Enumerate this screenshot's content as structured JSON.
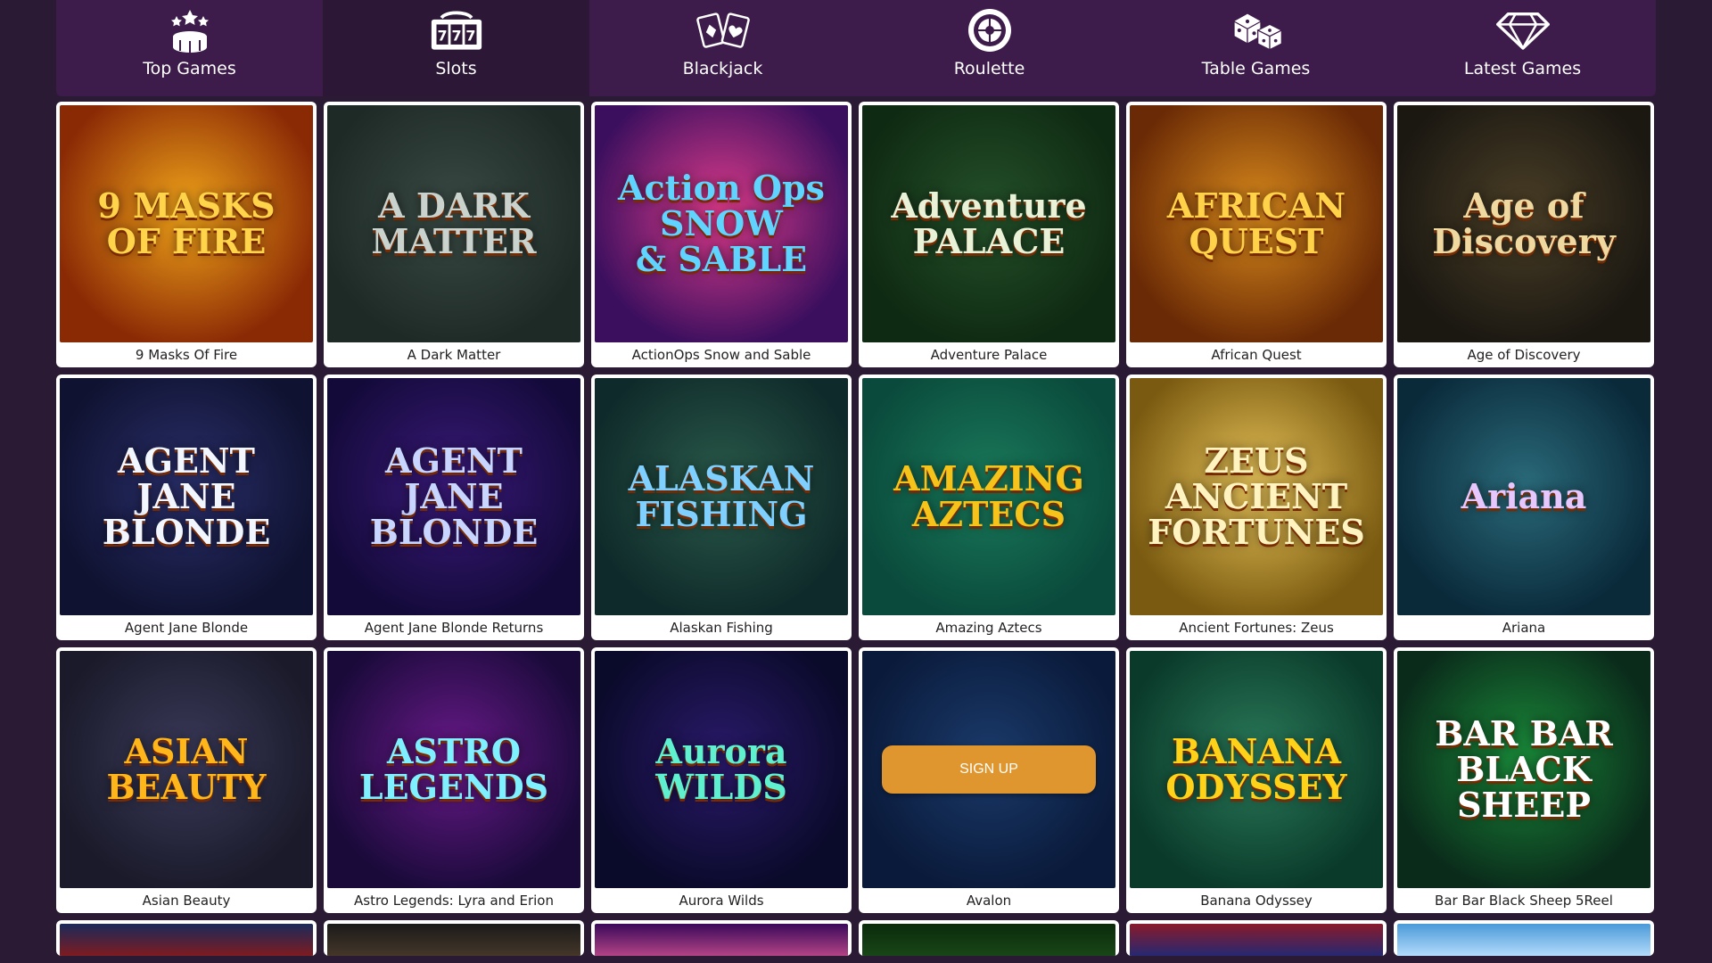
{
  "tabs": [
    {
      "label": "Top Games",
      "icon": "top-games-icon",
      "active": false
    },
    {
      "label": "Slots",
      "icon": "slot-machine-icon",
      "active": true
    },
    {
      "label": "Blackjack",
      "icon": "cards-icon",
      "active": false
    },
    {
      "label": "Roulette",
      "icon": "roulette-icon",
      "active": false
    },
    {
      "label": "Table Games",
      "icon": "dice-icon",
      "active": false
    },
    {
      "label": "Latest Games",
      "icon": "diamond-icon",
      "active": false
    }
  ],
  "games": [
    {
      "name": "9 Masks Of Fire",
      "art": "9 MASKS\nOF FIRE",
      "bg": "#8a2a05",
      "bg2": "#f2a51a",
      "ink": "#ffd34a"
    },
    {
      "name": "A Dark Matter",
      "art": "A DARK\nMATTER",
      "bg": "#1e2a26",
      "bg2": "#3a4a44",
      "ink": "#c9d2cc"
    },
    {
      "name": "ActionOps Snow and Sable",
      "art": "Action Ops\nSNOW\n& SABLE",
      "bg": "#3b0f5e",
      "bg2": "#e03c8c",
      "ink": "#5fd4ff"
    },
    {
      "name": "Adventure Palace",
      "art": "Adventure\nPALACE",
      "bg": "#0f2a12",
      "bg2": "#24502a",
      "ink": "#e9f1d6"
    },
    {
      "name": "African Quest",
      "art": "AFRICAN\nQUEST",
      "bg": "#6a2a05",
      "bg2": "#d98a1c",
      "ink": "#ffd24a"
    },
    {
      "name": "Age of Discovery",
      "art": "Age of\nDiscovery",
      "bg": "#1b1812",
      "bg2": "#4a3e26",
      "ink": "#f0d9a0"
    },
    {
      "name": "Agent Jane Blonde",
      "art": "AGENT JANE\nBLONDE",
      "bg": "#0f1230",
      "bg2": "#2a2f6a",
      "ink": "#f2f6ff"
    },
    {
      "name": "Agent Jane Blonde Returns",
      "art": "AGENT\nJANE\nBLONDE",
      "bg": "#140a3a",
      "bg2": "#3a1a7a",
      "ink": "#c8d6ff"
    },
    {
      "name": "Alaskan Fishing",
      "art": "ALASKAN\nFISHING",
      "bg": "#0f2a2a",
      "bg2": "#2a5a4a",
      "ink": "#7fd0ff"
    },
    {
      "name": "Amazing Aztecs",
      "art": "AMAZING\nAZTECS",
      "bg": "#0a4a3c",
      "bg2": "#1a7a5a",
      "ink": "#f5c31a"
    },
    {
      "name": "Ancient Fortunes: Zeus",
      "art": "ZEUS\nANCIENT FORTUNES",
      "bg": "#7a5a10",
      "bg2": "#e8c45a",
      "ink": "#fff3c0"
    },
    {
      "name": "Ariana",
      "art": "Ariana",
      "bg": "#0a2a3a",
      "bg2": "#2a6a7a",
      "ink": "#e6c8ff"
    },
    {
      "name": "Asian Beauty",
      "art": "ASIAN\nBEAUTY",
      "bg": "#1a1a2a",
      "bg2": "#3a3a5a",
      "ink": "#ffb61a"
    },
    {
      "name": "Astro Legends: Lyra and Erion",
      "art": "ASTRO\nLEGENDS",
      "bg": "#1a0a3a",
      "bg2": "#6a1a8a",
      "ink": "#7ff0ff"
    },
    {
      "name": "Aurora Wilds",
      "art": "Aurora\nWILDS",
      "bg": "#0a0a2a",
      "bg2": "#2a1a6a",
      "ink": "#5ff0d0"
    },
    {
      "name": "Avalon",
      "art": "",
      "bg": "#0a1a3a",
      "bg2": "#1a3a6a",
      "ink": "#cfe0ff"
    },
    {
      "name": "Banana Odyssey",
      "art": "BANANA\nODYSSEY",
      "bg": "#0a3a2a",
      "bg2": "#2a7a5a",
      "ink": "#ffd21a"
    },
    {
      "name": "Bar Bar Black Sheep 5Reel",
      "art": "BAR BAR\nBLACK\nSHEEP",
      "bg": "#0a2a1a",
      "bg2": "#1a8a3a",
      "ink": "#ffffff"
    }
  ],
  "partial_games": [
    {
      "bg": "#1a2a5a",
      "bg2": "#8a1a1a"
    },
    {
      "bg": "#1a1a1a",
      "bg2": "#4a3a2a"
    },
    {
      "bg": "#3a0a5a",
      "bg2": "#c04a8a"
    },
    {
      "bg": "#0a2a0a",
      "bg2": "#1a4a1a"
    },
    {
      "bg": "#8a1a2a",
      "bg2": "#1a2a7a"
    },
    {
      "bg": "#4a9ad8",
      "bg2": "#bfe2ff"
    }
  ],
  "signup": {
    "label": "SIGN UP"
  }
}
